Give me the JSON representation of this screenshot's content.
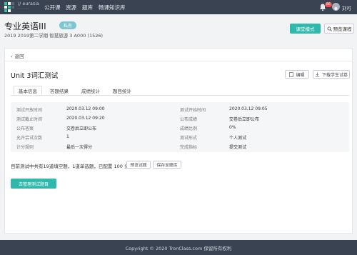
{
  "header": {
    "brand": "// eurasia",
    "brand_sub": "- - - - - -",
    "nav": [
      "公开课",
      "资源",
      "题库",
      "畅课知识库"
    ],
    "badge_count": "86",
    "username": "刘可"
  },
  "course": {
    "title": "专业英语III",
    "tag": "私有",
    "subtitle": "2019 2019第二学期 智慧旅游 3 A000 (1526)",
    "class_mode_label": "课堂模式",
    "preview_label": "预览课程"
  },
  "card": {
    "back_label": "返回",
    "test_title": "Unit 3词汇测试",
    "edit_label": "编辑",
    "download_label": "下载学生试卷",
    "tabs": [
      "基本信息",
      "答题结果",
      "成绩统计",
      "题目统计"
    ],
    "info_left": [
      {
        "label": "测试开放时间",
        "value": "2020.03.12 09:00"
      },
      {
        "label": "测试截止时间",
        "value": "2020.03.12 09:20"
      },
      {
        "label": "公布答案",
        "value": "交卷后立即公布"
      },
      {
        "label": "允许尝试次数",
        "value": "1"
      },
      {
        "label": "计分规则",
        "value": "最后一次得分"
      }
    ],
    "info_right": [
      {
        "label": "测试开始时间",
        "value": "2020.03.12 09:05"
      },
      {
        "label": "公布成绩",
        "value": "交卷后立即公布"
      },
      {
        "label": "成绩比例",
        "value": "0%"
      },
      {
        "label": "测试形式",
        "value": "个人测试"
      },
      {
        "label": "完成指标",
        "value": "提交测试"
      }
    ],
    "summary": "目前测试中共有19道填空题，1道单选题，已配置 100 分",
    "preview_paper_label": "预览试题",
    "save_bank_label": "保存至题库",
    "manage_label": "去管理测试题目"
  },
  "footer": {
    "text": "Copyright © 2020 TronClass.com 保留所有权利"
  }
}
